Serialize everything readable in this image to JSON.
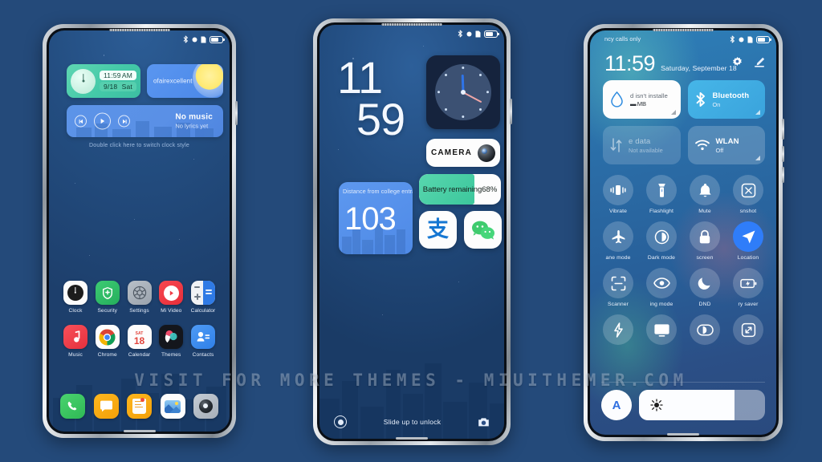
{
  "background_color": "#244a7a",
  "watermark": "VISIT FOR MORE THEMES - MIUITHEMER.COM",
  "phone1": {
    "name": "home-screen",
    "statusbar": {
      "icons": [
        "bluetooth-icon",
        "dot-icon",
        "sim-icon",
        "battery-icon"
      ]
    },
    "clock_widget": {
      "time": "11:59",
      "ampm": "AM",
      "date": "9/18",
      "weekday": "Sat"
    },
    "weather_widget": {
      "text": "ofairexcellent"
    },
    "music_widget": {
      "title": "No music",
      "subtitle": "No lyrics yet",
      "prev": "prev-icon",
      "play": "play-icon",
      "next": "next-icon"
    },
    "hint": "Double click here to switch clock style",
    "apps": [
      [
        {
          "label": "Clock",
          "icon": "clock-app-icon"
        },
        {
          "label": "Security",
          "icon": "security-app-icon"
        },
        {
          "label": "Settings",
          "icon": "settings-app-icon"
        },
        {
          "label": "Mi Video",
          "icon": "mi-video-app-icon"
        },
        {
          "label": "Calculator",
          "icon": "calculator-app-icon"
        }
      ],
      [
        {
          "label": "Music",
          "icon": "music-app-icon"
        },
        {
          "label": "Chrome",
          "icon": "chrome-app-icon"
        },
        {
          "label": "Calendar",
          "icon": "calendar-app-icon",
          "day_label": "SAT",
          "day_number": "18"
        },
        {
          "label": "Themes",
          "icon": "themes-app-icon"
        },
        {
          "label": "Contacts",
          "icon": "contacts-app-icon"
        }
      ]
    ],
    "dock": [
      {
        "icon": "phone-app-icon"
      },
      {
        "icon": "messages-app-icon"
      },
      {
        "icon": "notes-app-icon"
      },
      {
        "icon": "gallery-app-icon"
      },
      {
        "icon": "camera-app-icon"
      }
    ]
  },
  "phone2": {
    "name": "lock-screen",
    "statusbar": {
      "icons": [
        "bluetooth-icon",
        "dot-icon",
        "sim-icon",
        "battery-icon"
      ]
    },
    "big_time": {
      "line1": "11",
      "line2": "59"
    },
    "analog_clock": {
      "hour_angle": 358,
      "minute_angle": 118
    },
    "camera_widget": {
      "label": "CAMERA"
    },
    "countdown_widget": {
      "caption": "Distance from college entrance examination already",
      "days": "103"
    },
    "battery_widget": {
      "text": "Battery remaining68%",
      "percent": 68
    },
    "shortcuts": [
      {
        "name": "alipay-shortcut",
        "glyph": "支"
      },
      {
        "name": "wechat-shortcut",
        "glyph": "wechat-icon"
      }
    ],
    "unlock_text": "Slide up to unlock",
    "left_icon": "flashlight-ring-icon",
    "right_icon": "camera-icon"
  },
  "phone3": {
    "name": "control-center",
    "carrier": "ncy calls only",
    "statusbar": {
      "icons": [
        "bluetooth-icon",
        "dot-icon",
        "sim-icon",
        "battery-icon"
      ]
    },
    "time": "11:59",
    "date": "Saturday, September 18",
    "header_actions": [
      "settings-gear-icon",
      "edit-icon"
    ],
    "big_cards": [
      {
        "title": "d isn't installe",
        "subtitle": "MB",
        "icon": "data-usage-icon",
        "style": "white"
      },
      {
        "title": "Bluetooth",
        "subtitle": "On",
        "icon": "bluetooth-icon",
        "style": "blue"
      },
      {
        "title": "e data",
        "subtitle": "Not available",
        "icon": "mobile-data-icon",
        "style": "dim"
      },
      {
        "title": "WLAN",
        "subtitle": "Off",
        "icon": "wifi-icon",
        "style": "dim2"
      }
    ],
    "toggles": [
      [
        {
          "label": "Vibrate",
          "icon": "vibrate-icon",
          "active": false
        },
        {
          "label": "Flashlight",
          "icon": "flashlight-icon",
          "active": false
        },
        {
          "label": "Mute",
          "icon": "bell-icon",
          "active": false
        },
        {
          "label": "snshot",
          "icon": "screenshot-icon",
          "active": false
        }
      ],
      [
        {
          "label": "ane mode",
          "icon": "airplane-icon",
          "active": false
        },
        {
          "label": "Dark mode",
          "icon": "dark-mode-icon",
          "active": false
        },
        {
          "label": "screen",
          "icon": "lock-icon",
          "active": false
        },
        {
          "label": "Location",
          "icon": "location-icon",
          "active": true
        }
      ],
      [
        {
          "label": "Scanner",
          "icon": "scanner-icon",
          "active": false
        },
        {
          "label": "ing mode",
          "icon": "eye-icon",
          "active": false
        },
        {
          "label": "DND",
          "icon": "moon-icon",
          "active": false
        },
        {
          "label": "ry saver",
          "icon": "battery-saver-icon",
          "active": false
        }
      ],
      [
        {
          "label": "",
          "icon": "bolt-icon",
          "active": false
        },
        {
          "label": "",
          "icon": "cast-icon",
          "active": false
        },
        {
          "label": "",
          "icon": "reading-icon",
          "active": false
        },
        {
          "label": "",
          "icon": "fullscreen-icon",
          "active": false
        }
      ]
    ],
    "brightness": {
      "auto_label": "A",
      "icon": "sun-icon",
      "value": 76
    }
  }
}
